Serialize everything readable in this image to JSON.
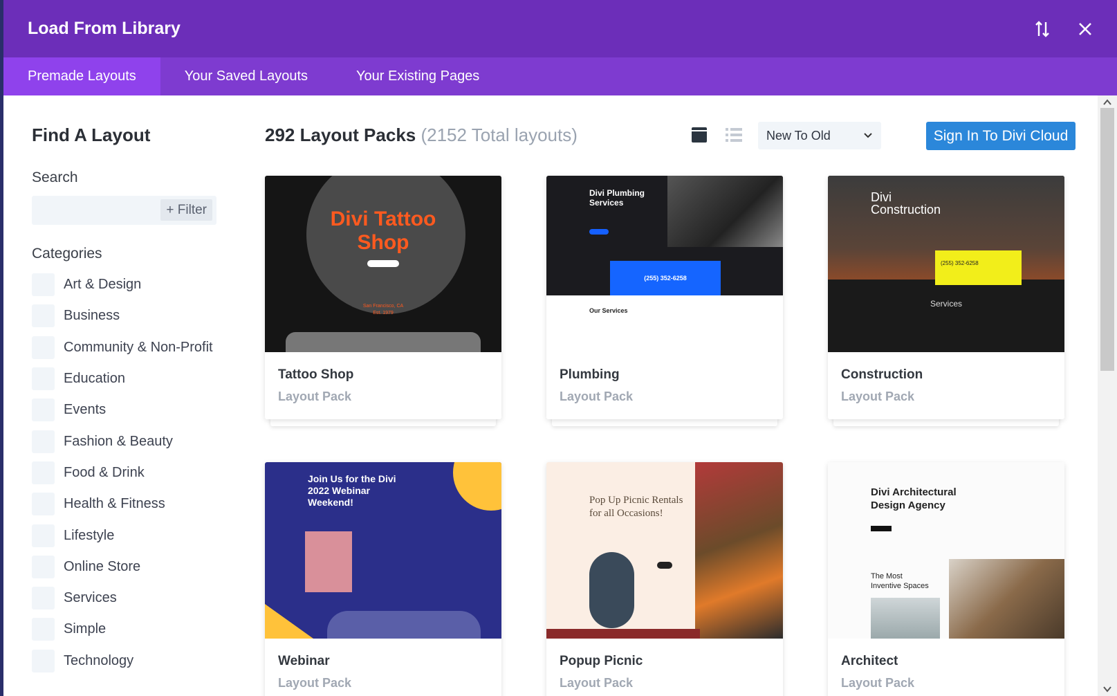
{
  "header": {
    "title": "Load From Library"
  },
  "tabs": [
    {
      "label": "Premade Layouts",
      "active": true
    },
    {
      "label": "Your Saved Layouts",
      "active": false
    },
    {
      "label": "Your Existing Pages",
      "active": false
    }
  ],
  "sidebar": {
    "title": "Find A Layout",
    "search_label": "Search",
    "search_placeholder": "",
    "filter_label": "+ Filter",
    "categories_label": "Categories",
    "categories": [
      "Art & Design",
      "Business",
      "Community & Non-Profit",
      "Education",
      "Events",
      "Fashion & Beauty",
      "Food & Drink",
      "Health & Fitness",
      "Lifestyle",
      "Online Store",
      "Services",
      "Simple",
      "Technology"
    ]
  },
  "main": {
    "count_label": "292 Layout Packs",
    "total_label": "(2152 Total layouts)",
    "sort": {
      "selected": "New To Old"
    },
    "signin_label": "Sign In To Divi Cloud",
    "cards": [
      {
        "name": "Tattoo Shop",
        "type": "Layout Pack",
        "preview": {
          "title": "Divi Tattoo Shop",
          "line1": "Divi Tattoo",
          "line2": "Shop",
          "sub1": "San Francisco, CA",
          "sub2": "Est. 1979"
        }
      },
      {
        "name": "Plumbing",
        "type": "Layout Pack",
        "preview": {
          "title": "Divi Plumbing Services",
          "line1": "Divi Plumbing",
          "line2": "Services",
          "sub1": "(255) 352-6258",
          "sub2": "Our Services"
        }
      },
      {
        "name": "Construction",
        "type": "Layout Pack",
        "preview": {
          "title": "Divi Construction",
          "line1": "Divi",
          "line2": "Construction",
          "sub1": "(255) 352-6258",
          "sub2": "Services"
        }
      },
      {
        "name": "Webinar",
        "type": "Layout Pack",
        "preview": {
          "title": "Join Us for the Divi 2022 Webinar Weekend!",
          "line1": "Join Us for the Divi",
          "line2": "2022 Webinar",
          "line3": "Weekend!"
        }
      },
      {
        "name": "Popup Picnic",
        "type": "Layout Pack",
        "preview": {
          "title": "Pop Up Picnic Rentals for all Occasions!",
          "line1": "Pop Up Picnic Rentals",
          "line2": "for all Occasions!"
        }
      },
      {
        "name": "Architect",
        "type": "Layout Pack",
        "preview": {
          "title": "Divi Architectural Design Agency",
          "line1": "Divi Architectural",
          "line2": "Design Agency",
          "sub1": "The Most",
          "sub2": "Inventive Spaces"
        }
      }
    ]
  },
  "colors": {
    "header": "#6c2eb9",
    "tabs": "#7e3bd0",
    "active_tab": "#8f42ec",
    "button": "#2b87da"
  }
}
